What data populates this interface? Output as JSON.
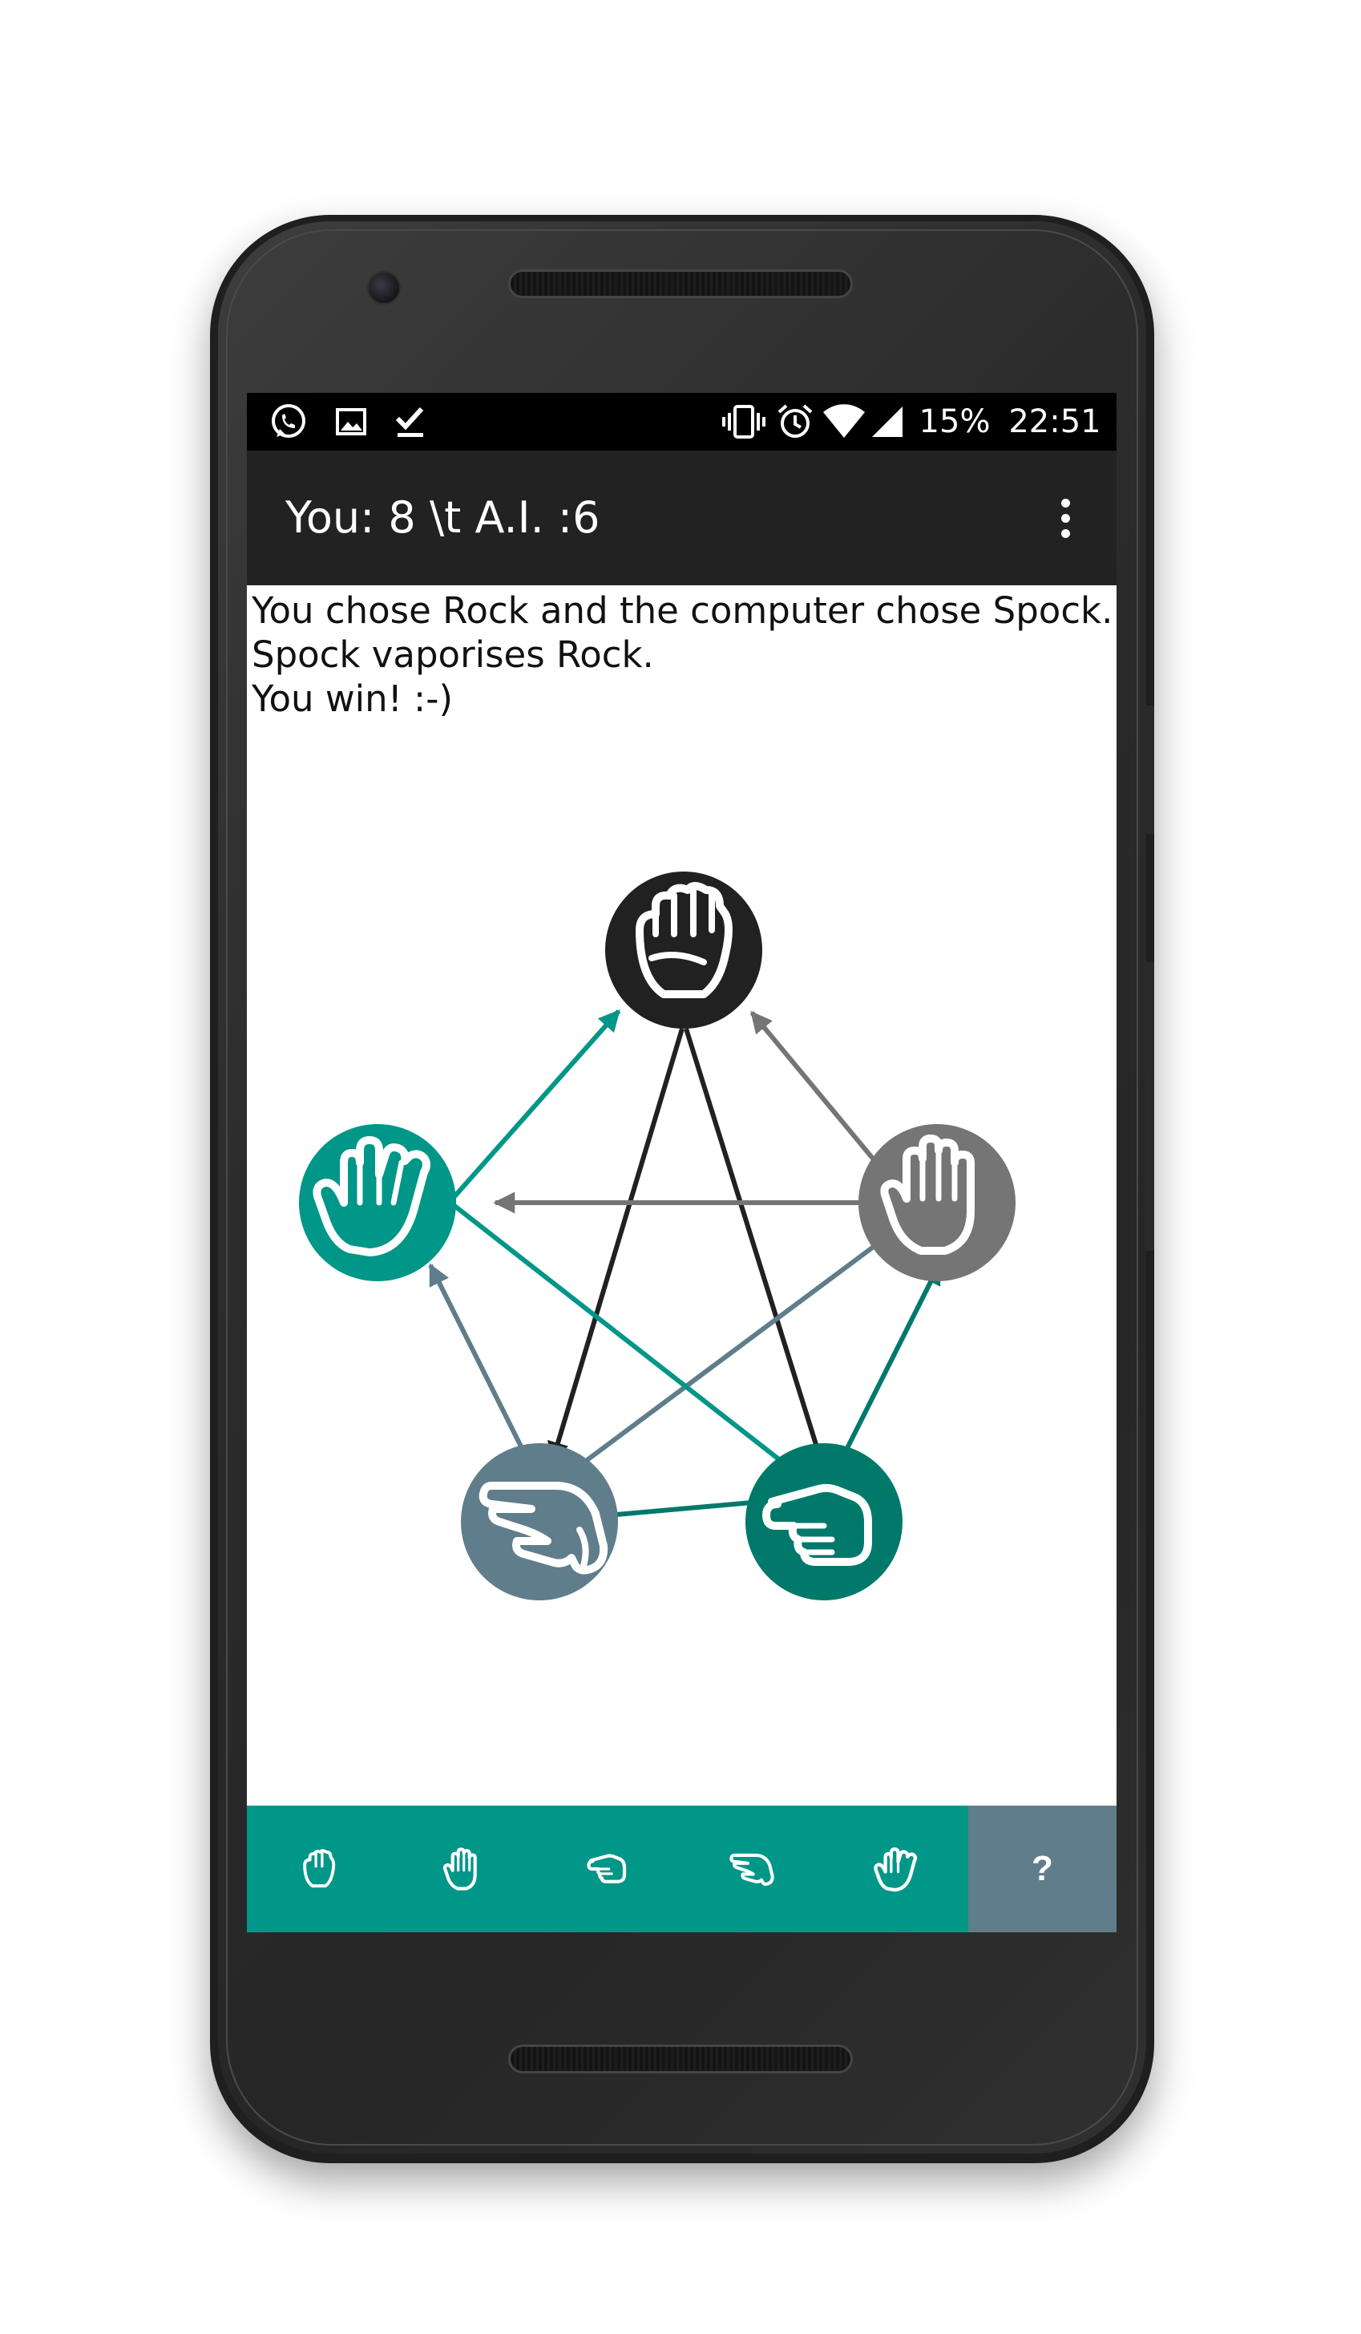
{
  "status_bar": {
    "battery": "15%",
    "time": "22:51",
    "notification_icons": [
      "whatsapp-icon",
      "image-icon",
      "download-done-icon"
    ],
    "system_icons": [
      "vibrate-icon",
      "alarm-icon",
      "wifi-icon",
      "signal-icon"
    ]
  },
  "app_bar": {
    "title": "You: 8 \\t A.I. :6",
    "menu_icon": "more-vert-icon"
  },
  "result": {
    "line1": "You chose Rock and the computer chose Spock.",
    "line2": "Spock vaporises Rock.",
    "line3": "You win! :-)"
  },
  "diagram": {
    "nodes": [
      {
        "name": "rock",
        "icon": "fist-icon",
        "color": "#212121"
      },
      {
        "name": "paper",
        "icon": "open-hand-icon",
        "color": "#757575"
      },
      {
        "name": "scissors",
        "icon": "scissors-hand-icon",
        "color": "#00796b"
      },
      {
        "name": "lizard",
        "icon": "lizard-hand-icon",
        "color": "#607d8b"
      },
      {
        "name": "spock",
        "icon": "spock-hand-icon",
        "color": "#009688"
      }
    ],
    "arrows": [
      {
        "from": "rock",
        "to": "scissors"
      },
      {
        "from": "rock",
        "to": "lizard"
      },
      {
        "from": "paper",
        "to": "rock"
      },
      {
        "from": "paper",
        "to": "spock"
      },
      {
        "from": "scissors",
        "to": "paper"
      },
      {
        "from": "scissors",
        "to": "lizard"
      },
      {
        "from": "lizard",
        "to": "paper"
      },
      {
        "from": "lizard",
        "to": "spock"
      },
      {
        "from": "spock",
        "to": "rock"
      },
      {
        "from": "spock",
        "to": "scissors"
      }
    ]
  },
  "bottom_bar": {
    "choices": [
      {
        "name": "rock",
        "icon": "fist-icon"
      },
      {
        "name": "paper",
        "icon": "open-hand-icon"
      },
      {
        "name": "scissors",
        "icon": "scissors-hand-icon"
      },
      {
        "name": "lizard",
        "icon": "lizard-hand-icon"
      },
      {
        "name": "spock",
        "icon": "spock-hand-icon"
      }
    ],
    "help_label": "?",
    "bar_color": "#009688",
    "help_color": "#607d8b"
  }
}
